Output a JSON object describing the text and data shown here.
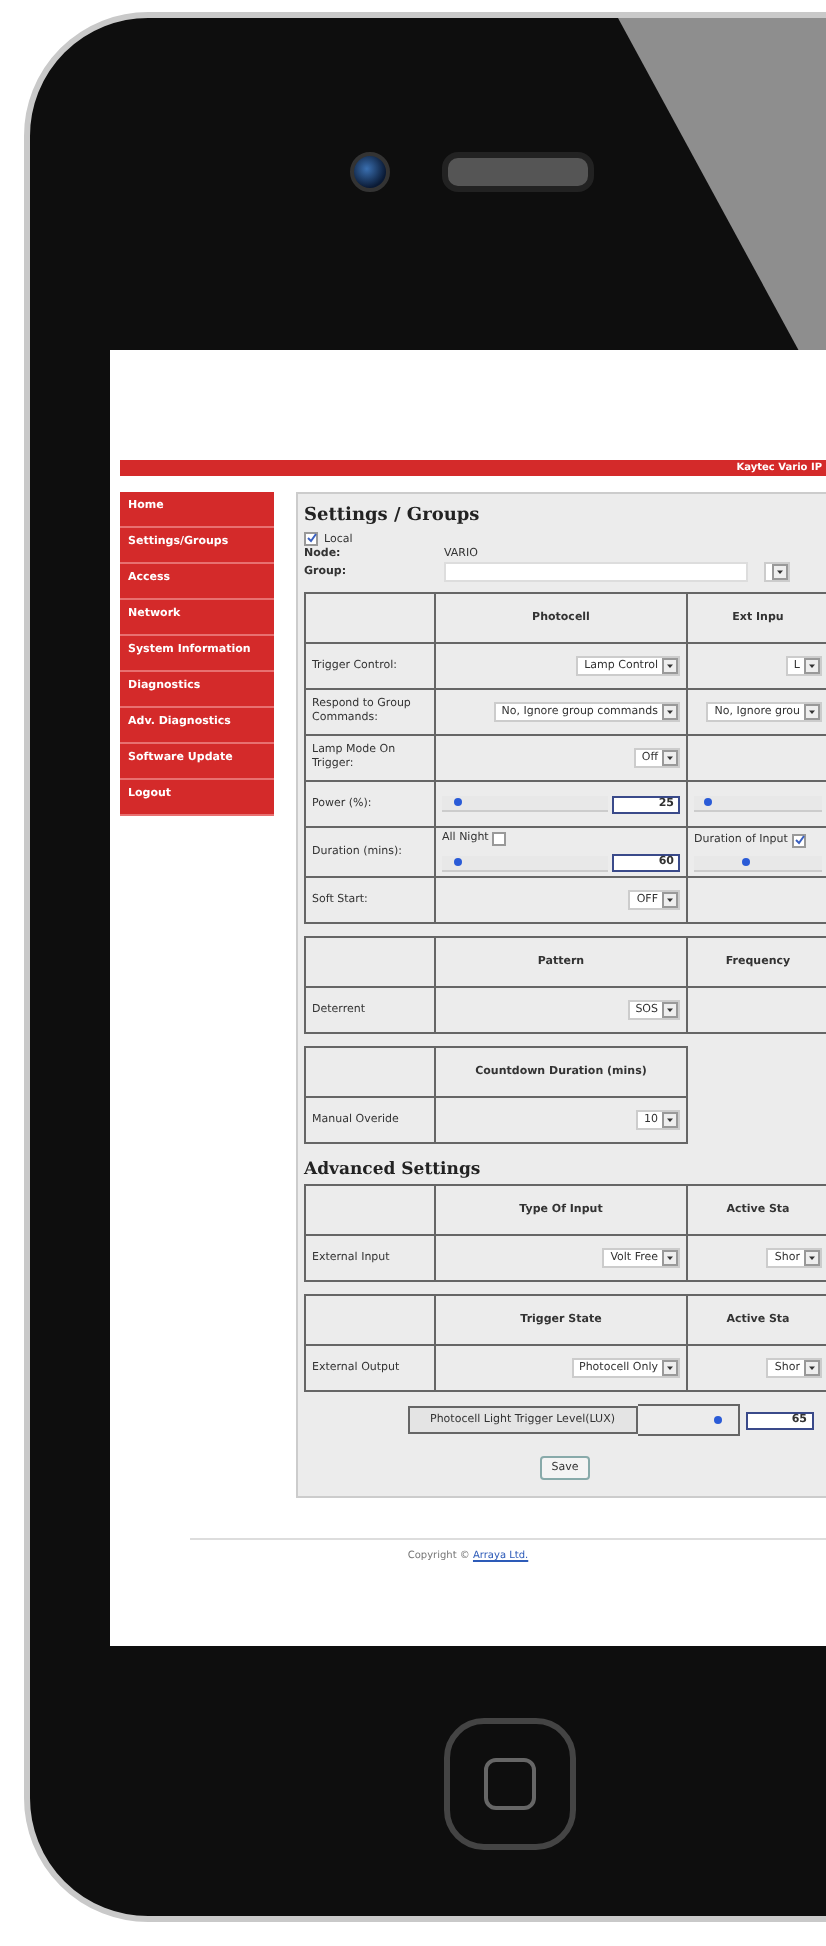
{
  "header": {
    "title": "Kaytec Vario IP"
  },
  "sidebar": {
    "items": [
      {
        "label": "Home",
        "selected": false
      },
      {
        "label": "Settings/Groups",
        "selected": false
      },
      {
        "label": "Access",
        "selected": false
      },
      {
        "label": "Network",
        "selected": false
      },
      {
        "label": "System Information",
        "selected": false
      },
      {
        "label": "Diagnostics",
        "selected": false
      },
      {
        "label": "Adv. Diagnostics",
        "selected": false
      },
      {
        "label": "Software Update",
        "selected": false
      },
      {
        "label": "Logout",
        "selected": false
      }
    ]
  },
  "page": {
    "title": "Settings / Groups",
    "local": {
      "label": "Local",
      "checked": true
    },
    "node": {
      "label": "Node:",
      "value": "VARIO"
    },
    "group": {
      "label": "Group:"
    }
  },
  "sections": [
    {
      "tables": [
        {
          "columns": [
            "Photocell",
            "Ext Inpu"
          ],
          "rows": [
            {
              "label": "Trigger Control:",
              "cells": [
                [
                  {
                    "kind": "select",
                    "value": "Lamp Control"
                  }
                ],
                [
                  {
                    "kind": "select",
                    "value": "L"
                  }
                ]
              ]
            },
            {
              "label": "Respond to Group Commands:",
              "cells": [
                [
                  {
                    "kind": "select",
                    "value": "No, Ignore group commands"
                  }
                ],
                [
                  {
                    "kind": "select",
                    "value": "No, Ignore grou"
                  }
                ]
              ]
            },
            {
              "label": "Lamp Mode On Trigger:",
              "cells": [
                [
                  {
                    "kind": "select",
                    "value": "Off"
                  }
                ],
                []
              ]
            },
            {
              "label": "Power (%):",
              "cells": [
                [
                  {
                    "kind": "slider",
                    "level": 0.05,
                    "value": "25"
                  }
                ],
                [
                  {
                    "kind": "slider",
                    "level": 0.05
                  }
                ]
              ]
            },
            {
              "label": "Duration (mins):",
              "cells": [
                [
                  {
                    "kind": "checkbox",
                    "label": "All Night",
                    "checked": false
                  },
                  {
                    "kind": "slider",
                    "level": 0.05,
                    "value": "60"
                  }
                ],
                [
                  {
                    "kind": "checkbox",
                    "label": "Duration of Input",
                    "checked": true
                  },
                  {
                    "kind": "slider",
                    "level": 0.4
                  }
                ]
              ]
            },
            {
              "label": "Soft Start:",
              "cells": [
                [
                  {
                    "kind": "select",
                    "value": "OFF"
                  }
                ],
                []
              ]
            }
          ]
        },
        {
          "columns": [
            "Pattern",
            "Frequency"
          ],
          "rows": [
            {
              "label": "Deterrent",
              "cells": [
                [
                  {
                    "kind": "select",
                    "value": "SOS"
                  }
                ],
                []
              ]
            }
          ]
        },
        {
          "columns": [
            "Countdown Duration (mins)"
          ],
          "rows": [
            {
              "label": "Manual Overide",
              "cells": [
                [
                  {
                    "kind": "select",
                    "value": "10"
                  }
                ]
              ]
            }
          ]
        }
      ]
    },
    {
      "heading": "Advanced Settings",
      "tables": [
        {
          "columns": [
            "Type Of Input",
            "Active Sta"
          ],
          "rows": [
            {
              "label": "External Input",
              "cells": [
                [
                  {
                    "kind": "select",
                    "value": "Volt Free"
                  }
                ],
                [
                  {
                    "kind": "select",
                    "value": "Shor"
                  }
                ]
              ]
            }
          ]
        },
        {
          "columns": [
            "Trigger State",
            "Active Sta"
          ],
          "rows": [
            {
              "label": "External Output",
              "cells": [
                [
                  {
                    "kind": "select",
                    "value": "Photocell Only"
                  }
                ],
                [
                  {
                    "kind": "select",
                    "value": "Shor"
                  }
                ]
              ]
            }
          ]
        }
      ]
    }
  ],
  "light_trigger": {
    "label": "Photocell Light Trigger Level(LUX)",
    "level": 0.85,
    "value": "65"
  },
  "save_button": "Save",
  "footer": {
    "text": "Copyright ©",
    "link": "Arraya Ltd."
  }
}
